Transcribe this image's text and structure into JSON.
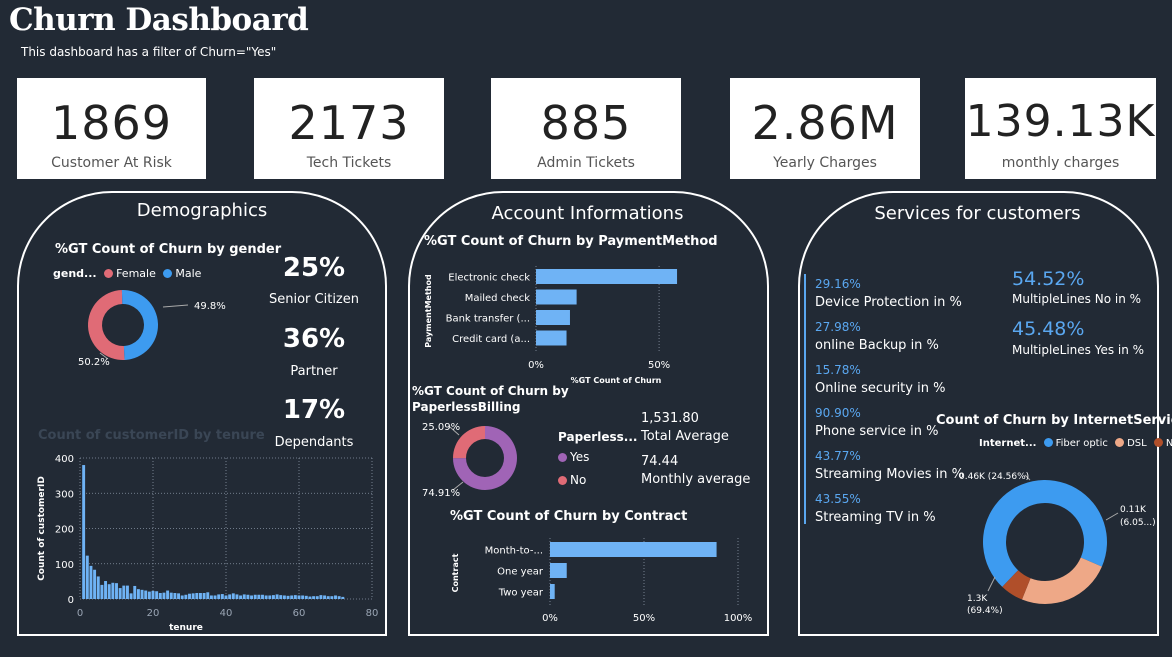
{
  "header": {
    "title": "Churn Dashboard",
    "subtitle": "This dashboard has a filter of Churn=\"Yes\""
  },
  "kpis": [
    {
      "value": "1869",
      "label": "Customer At Risk"
    },
    {
      "value": "2173",
      "label": "Tech Tickets"
    },
    {
      "value": "885",
      "label": "Admin Tickets"
    },
    {
      "value": "2.86M",
      "label": "Yearly Charges"
    },
    {
      "value": "139.13K",
      "label": "monthly charges"
    }
  ],
  "demographics": {
    "title": "Demographics",
    "gender_chart_title": "%GT Count of Churn by gender",
    "stats": [
      {
        "value": "25%",
        "label": "Senior Citizen"
      },
      {
        "value": "36%",
        "label": "Partner"
      },
      {
        "value": "17%",
        "label": "Dependants"
      }
    ]
  },
  "account": {
    "title": "Account Informations",
    "billing_avg_value": "1,531.80",
    "billing_avg_label": "Total Average",
    "monthly_avg_value": "74.44",
    "monthly_avg_label": "Monthly average"
  },
  "services": {
    "title": "Services for customers",
    "items": [
      {
        "pct": "29.16%",
        "label": "Device Protection in %"
      },
      {
        "pct": "27.98%",
        "label": "online Backup in %"
      },
      {
        "pct": "15.78%",
        "label": "Online security in %"
      },
      {
        "pct": "90.90%",
        "label": "Phone service in %"
      },
      {
        "pct": "43.77%",
        "label": "Streaming Movies in %"
      },
      {
        "pct": "43.55%",
        "label": "Streaming TV in %"
      }
    ],
    "multiline": [
      {
        "pct": "54.52%",
        "label": "MultipleLines No in %"
      },
      {
        "pct": "45.48%",
        "label": "MultipleLines Yes in %"
      }
    ]
  },
  "colors": {
    "background": "#222a35",
    "bar": "#6fb3f5",
    "male": "#3d9bf0",
    "female": "#e06b76",
    "paperless_yes": "#a064b6",
    "paperless_no": "#e06b76",
    "fiber": "#3d9bf0",
    "dsl": "#eea887",
    "no_internet": "#b04f2a"
  },
  "chart_data": [
    {
      "id": "gender",
      "type": "pie",
      "title": "%GT Count of Churn by gender",
      "legend_title": "gend...",
      "legend_position": "top-left",
      "categories": [
        "Female",
        "Male"
      ],
      "values": [
        50.2,
        49.8
      ],
      "labels": [
        "50.2%",
        "49.8%"
      ]
    },
    {
      "id": "tenure",
      "type": "bar",
      "title": "Count of customerID by tenure",
      "xlabel": "tenure",
      "ylabel": "Count of customerID",
      "xlim": [
        0,
        80
      ],
      "ylim": [
        0,
        400
      ],
      "xticks": [
        "0",
        "20",
        "40",
        "60",
        "80"
      ],
      "yticks": [
        "0",
        "100",
        "200",
        "300",
        "400"
      ],
      "grid": true,
      "x": [
        1,
        2,
        3,
        4,
        5,
        6,
        7,
        8,
        9,
        10,
        11,
        12,
        13,
        14,
        15,
        16,
        17,
        18,
        19,
        20,
        21,
        22,
        23,
        24,
        25,
        26,
        27,
        28,
        29,
        30,
        31,
        32,
        33,
        34,
        35,
        36,
        37,
        38,
        39,
        40,
        41,
        42,
        43,
        44,
        45,
        46,
        47,
        48,
        49,
        50,
        51,
        52,
        53,
        54,
        55,
        56,
        57,
        58,
        59,
        60,
        61,
        62,
        63,
        64,
        65,
        66,
        67,
        68,
        69,
        70,
        71,
        72
      ],
      "values": [
        380,
        123,
        94,
        83,
        64,
        40,
        51,
        42,
        46,
        45,
        31,
        38,
        38,
        16,
        37,
        28,
        26,
        24,
        21,
        23,
        22,
        17,
        18,
        24,
        18,
        17,
        16,
        10,
        12,
        15,
        16,
        17,
        17,
        17,
        19,
        10,
        10,
        13,
        14,
        10,
        13,
        16,
        13,
        10,
        13,
        12,
        10,
        12,
        12,
        12,
        10,
        10,
        11,
        13,
        11,
        10,
        9,
        10,
        11,
        10,
        10,
        9,
        7,
        8,
        8,
        11,
        10,
        8,
        8,
        10,
        8,
        6
      ]
    },
    {
      "id": "payment",
      "type": "bar",
      "orientation": "horizontal",
      "title": "%GT Count of Churn by PaymentMethod",
      "xlabel": "%GT Count of Churn",
      "ylabel": "PaymentMethod",
      "categories": [
        "Electronic check",
        "Mailed check",
        "Bank transfer (...",
        "Credit card (a..."
      ],
      "values": [
        57.3,
        16.5,
        13.8,
        12.4
      ],
      "xlim": [
        0,
        65
      ],
      "xticks": [
        "0%",
        "50%"
      ],
      "grid": true
    },
    {
      "id": "paperless",
      "type": "pie",
      "title": "%GT Count of Churn by PaperlessBilling",
      "title_line1": "%GT Count of Churn by",
      "title_line2": "PaperlessBilling",
      "legend_title": "Paperless...",
      "categories": [
        "Yes",
        "No"
      ],
      "values": [
        74.91,
        25.09
      ],
      "labels": [
        "74.91%",
        "25.09%"
      ]
    },
    {
      "id": "contract",
      "type": "bar",
      "orientation": "horizontal",
      "title": "%GT Count of Churn by Contract",
      "ylabel": "Contract",
      "categories": [
        "Month-to-...",
        "One year",
        "Two year"
      ],
      "values": [
        88.6,
        8.9,
        2.5
      ],
      "xlim": [
        0,
        100
      ],
      "xticks": [
        "0%",
        "50%",
        "100%"
      ],
      "grid": true
    },
    {
      "id": "internet",
      "type": "pie",
      "title": "Count of Churn by InternetService",
      "legend_title": "Internet...",
      "categories": [
        "Fiber optic",
        "DSL",
        "No"
      ],
      "values": [
        1297,
        459,
        113
      ],
      "labels": [
        "1.3K\n(69.4%)",
        "0.46K (24.56%)",
        "0.11K\n(6.05...)"
      ]
    }
  ]
}
